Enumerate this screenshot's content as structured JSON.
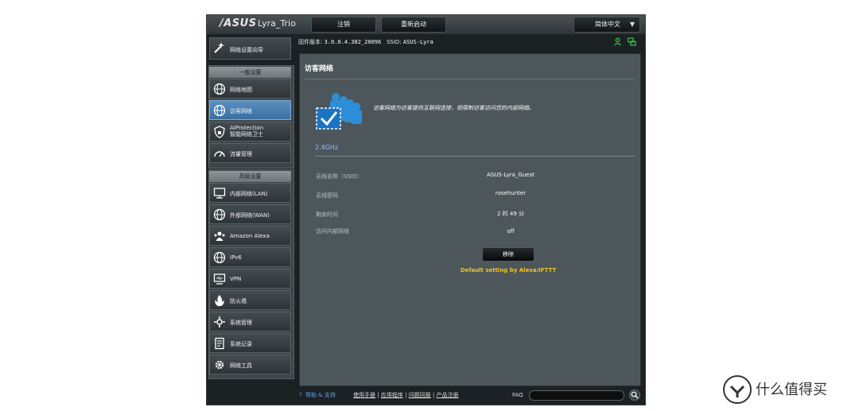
{
  "header": {
    "brand": "/ASUS",
    "model": "Lyra_Trio",
    "logout_label": "注销",
    "reboot_label": "重新启动",
    "language": "简体中文"
  },
  "infobar": {
    "firmware_label": "固件版本:",
    "firmware_value": "3.0.0.4.382_20096",
    "ssid_label": "SSID:",
    "ssid_value": "ASUS-Lyra"
  },
  "sidebar": {
    "wizard": "网络设置向导",
    "general_title": "一般设置",
    "general": [
      {
        "label": "网络地图"
      },
      {
        "label": "访客网络"
      },
      {
        "label": "AiProtection",
        "label2": "智能网络卫士"
      },
      {
        "label": "流量管理"
      }
    ],
    "advanced_title": "高级设置",
    "advanced": [
      {
        "label": "内部网络(LAN)"
      },
      {
        "label": "外部网络(WAN)"
      },
      {
        "label": "Amazon Alexa"
      },
      {
        "label": "IPv6"
      },
      {
        "label": "VPN"
      },
      {
        "label": "防火墙"
      },
      {
        "label": "系统管理"
      },
      {
        "label": "系统记录"
      },
      {
        "label": "网络工具"
      }
    ]
  },
  "content": {
    "title": "访客网络",
    "description": "访客网络为访客提供互联网连接，但限制访客访问您的内部网络。",
    "band": "2.4GHz",
    "rows": [
      {
        "label": "无线名称（SSID）",
        "value": "ASUS-Lyra_Guest"
      },
      {
        "label": "无线密码",
        "value": "rosehunter"
      },
      {
        "label": "剩余时间",
        "value": "2 时 49 分"
      },
      {
        "label": "访问内部网络",
        "value": "off"
      }
    ],
    "remove_label": "移除",
    "default_link": "Default setting by Alexa/IFTTT"
  },
  "footer": {
    "help": "帮助 & 支持",
    "manual": "使用手册",
    "utility": "应用程序",
    "feedback": "问题回报",
    "registration": "产品注册",
    "faq": "FAQ"
  },
  "watermark": {
    "logo_glyph": "值",
    "text": "什么值得买"
  },
  "colors": {
    "accent": "#3a6fa0",
    "link": "#f2c41c",
    "band": "#8fc1ff",
    "online": "#39c24a"
  }
}
